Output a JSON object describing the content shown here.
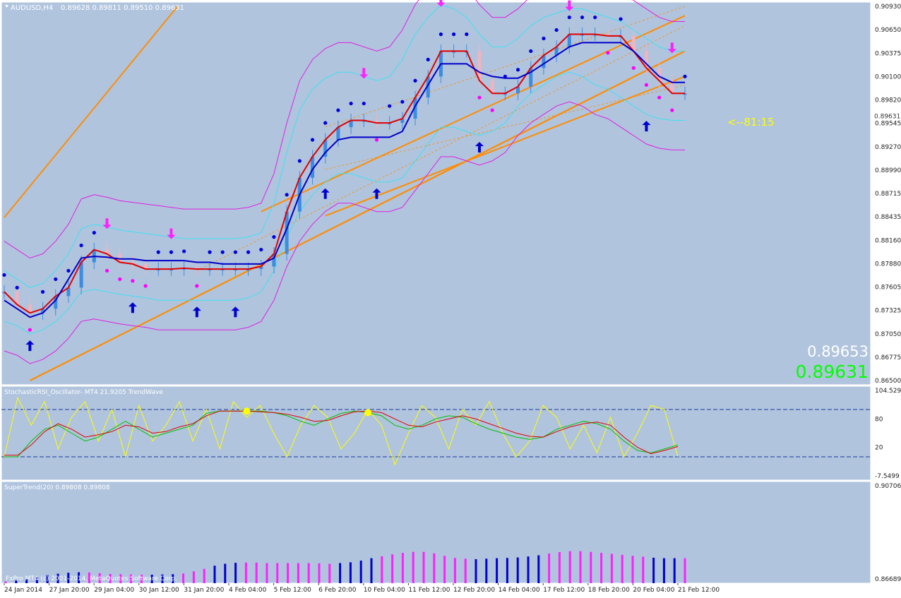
{
  "window": {
    "symbol_label": "AUDUSD,H4",
    "ohlc": "0.89628 0.89811 0.89510 0.89631",
    "arrow_icon": "triangle-down-icon"
  },
  "colors": {
    "background": "#b0c4de",
    "frame": "#ffffff",
    "text": "#ffffff",
    "orange": "#ff8c00",
    "cyan": "#40e0f0",
    "magenta": "#e020e0",
    "red": "#e00000",
    "blue": "#0000c8",
    "dot_blue": "#0000e0",
    "dot_magenta": "#ff00ff",
    "candle_blue": "#3c8ce0",
    "candle_pink": "#f0b4c0",
    "yellow": "#ffff00",
    "green": "#00c000",
    "bid_green": "#00ff00",
    "hist_blue": "#0000d0",
    "hist_magenta": "#ff20ff"
  },
  "chart_data": [
    {
      "type": "line",
      "name": "main",
      "ylim": [
        0.865,
        0.9093
      ],
      "y_ticks": [
        "0.90930",
        "0.90650",
        "0.90375",
        "0.90100",
        "0.89820",
        "0.89545",
        "0.89270",
        "0.88990",
        "0.88715",
        "0.88435",
        "0.88160",
        "0.87880",
        "0.87605",
        "0.87325",
        "0.87050",
        "0.86775",
        "0.86500"
      ],
      "current_price_tag": "0.89631",
      "countdown_label": "<--81:15",
      "ask_label": "0.89653",
      "bid_label": "0.89631",
      "series": [
        {
          "values": [
            0.8755,
            0.874,
            0.873,
            0.8735,
            0.875,
            0.876,
            0.879,
            0.8805,
            0.88,
            0.879,
            0.8788,
            0.8782,
            0.8782,
            0.8782,
            0.8783,
            0.8782,
            0.8782,
            0.8782,
            0.8782,
            0.8782,
            0.8785,
            0.88,
            0.885,
            0.889,
            0.8915,
            0.8935,
            0.895,
            0.8958,
            0.8958,
            0.8955,
            0.8955,
            0.896,
            0.8985,
            0.901,
            0.904,
            0.904,
            0.904,
            0.9005,
            0.899,
            0.899,
            0.8998,
            0.902,
            0.9035,
            0.9045,
            0.906,
            0.906,
            0.906,
            0.9058,
            0.9058,
            0.904,
            0.902,
            0.9005,
            0.899,
            0.899
          ]
        },
        {
          "values": [
            0.8745,
            0.8735,
            0.8725,
            0.873,
            0.8745,
            0.877,
            0.8795,
            0.8797,
            0.8796,
            0.8794,
            0.8794,
            0.8792,
            0.8792,
            0.8792,
            0.8792,
            0.879,
            0.879,
            0.8788,
            0.8788,
            0.8788,
            0.8788,
            0.8795,
            0.883,
            0.887,
            0.89,
            0.892,
            0.8935,
            0.8938,
            0.8938,
            0.8938,
            0.8938,
            0.8945,
            0.8975,
            0.9,
            0.9025,
            0.9025,
            0.9025,
            0.9015,
            0.901,
            0.9008,
            0.9008,
            0.9015,
            0.9025,
            0.9035,
            0.9045,
            0.905,
            0.905,
            0.905,
            0.905,
            0.904,
            0.9025,
            0.901,
            0.9003,
            0.9003
          ]
        },
        {
          "values": [
            0.878,
            0.877,
            0.876,
            0.8765,
            0.878,
            0.88,
            0.883,
            0.8835,
            0.8832,
            0.8828,
            0.8826,
            0.8824,
            0.8822,
            0.882,
            0.8818,
            0.8818,
            0.8818,
            0.8818,
            0.8818,
            0.882,
            0.8825,
            0.886,
            0.892,
            0.897,
            0.8995,
            0.9008,
            0.9015,
            0.9015,
            0.901,
            0.9005,
            0.901,
            0.903,
            0.906,
            0.908,
            0.9095,
            0.909,
            0.908,
            0.906,
            0.9045,
            0.9045,
            0.9055,
            0.907,
            0.908,
            0.9085,
            0.909,
            0.909,
            0.9085,
            0.908,
            0.9075,
            0.9065,
            0.9055,
            0.9045,
            0.904,
            0.904
          ]
        },
        {
          "values": [
            0.872,
            0.8715,
            0.8705,
            0.871,
            0.872,
            0.8735,
            0.8755,
            0.8758,
            0.8755,
            0.8752,
            0.875,
            0.8748,
            0.8745,
            0.8745,
            0.8745,
            0.8745,
            0.8745,
            0.8745,
            0.8745,
            0.8748,
            0.8755,
            0.878,
            0.882,
            0.885,
            0.887,
            0.8885,
            0.8895,
            0.8895,
            0.889,
            0.8885,
            0.8885,
            0.889,
            0.891,
            0.893,
            0.895,
            0.895,
            0.8945,
            0.894,
            0.8945,
            0.8955,
            0.8975,
            0.899,
            0.9,
            0.901,
            0.9015,
            0.901,
            0.9,
            0.8995,
            0.8985,
            0.8975,
            0.8965,
            0.896,
            0.8958,
            0.8958
          ]
        }
      ]
    },
    {
      "type": "line",
      "name": "oscillator",
      "title": "StochasticRSI_Oscillator- MT4 21.9205  TrendWave",
      "ylim": [
        -5,
        105
      ],
      "y_ticks": [
        "104.529",
        "80",
        "20",
        "-7.5499"
      ],
      "levels": [
        80,
        20
      ],
      "series": [
        {
          "values": [
            20,
            95,
            60,
            90,
            30,
            70,
            90,
            40,
            80,
            20,
            85,
            40,
            60,
            90,
            40,
            80,
            30,
            90,
            70,
            85,
            50,
            20,
            60,
            85,
            70,
            30,
            50,
            80,
            60,
            10,
            50,
            85,
            70,
            30,
            80,
            60,
            90,
            50,
            20,
            40,
            85,
            70,
            30,
            60,
            25,
            70,
            20,
            50,
            85,
            80,
            20
          ]
        },
        {
          "values": [
            20,
            20,
            40,
            55,
            60,
            50,
            40,
            45,
            55,
            65,
            55,
            45,
            50,
            55,
            60,
            75,
            78,
            78,
            78,
            78,
            76,
            72,
            65,
            60,
            68,
            75,
            78,
            76,
            72,
            60,
            55,
            60,
            68,
            72,
            70,
            62,
            55,
            50,
            45,
            42,
            45,
            55,
            60,
            65,
            62,
            55,
            40,
            28,
            25,
            30,
            35
          ]
        },
        {
          "values": [
            22,
            22,
            35,
            52,
            62,
            55,
            45,
            48,
            52,
            60,
            58,
            50,
            52,
            58,
            62,
            72,
            78,
            78,
            78,
            77,
            76,
            74,
            70,
            65,
            66,
            72,
            77,
            78,
            76,
            68,
            60,
            58,
            64,
            68,
            72,
            68,
            62,
            56,
            50,
            46,
            45,
            52,
            58,
            62,
            64,
            60,
            45,
            32,
            24,
            28,
            33
          ]
        }
      ]
    },
    {
      "type": "bar",
      "name": "supertrend",
      "title": "SuperTrend(20) 0.89808 0.89808",
      "ylim": [
        0.8669,
        0.90706
      ],
      "y_ticks": [
        "0.90706",
        "0.86689"
      ],
      "values": [
        0.8676,
        0.868,
        0.8686,
        0.8694,
        0.8702,
        0.8708,
        0.8712,
        0.8714,
        0.8713,
        0.871,
        0.8707,
        0.8706,
        0.8705,
        0.8704,
        0.8704,
        0.8705,
        0.8706,
        0.8709,
        0.8718,
        0.8728,
        0.8741,
        0.8749,
        0.8753,
        0.8754,
        0.8754,
        0.8752,
        0.8752,
        0.8752,
        0.8752,
        0.8752,
        0.8751,
        0.8749,
        0.8752,
        0.8755,
        0.8762,
        0.8772,
        0.878,
        0.8788,
        0.8794,
        0.8798,
        0.8798,
        0.8792,
        0.8782,
        0.8773,
        0.877,
        0.8768,
        0.877,
        0.8772,
        0.8773,
        0.8775,
        0.8779,
        0.8784,
        0.8791,
        0.8797,
        0.8801,
        0.8801,
        0.8798,
        0.8794,
        0.879,
        0.8786,
        0.8782,
        0.8778,
        0.8774,
        0.8772,
        0.8772,
        0.8772
      ],
      "colors": [
        "m",
        "b",
        "b",
        "b",
        "b",
        "b",
        "b",
        "b",
        "m",
        "m",
        "m",
        "m",
        "m",
        "m",
        "b",
        "b",
        "b",
        "m",
        "m",
        "m",
        "b",
        "b",
        "b",
        "m",
        "m",
        "m",
        "m",
        "m",
        "m",
        "m",
        "m",
        "m",
        "b",
        "b",
        "b",
        "b",
        "m",
        "m",
        "m",
        "m",
        "m",
        "m",
        "m",
        "m",
        "m",
        "b",
        "b",
        "b",
        "b",
        "b",
        "b",
        "b",
        "m",
        "m",
        "m",
        "m",
        "m",
        "m",
        "m",
        "m",
        "m",
        "m",
        "b",
        "b",
        "b",
        "m"
      ]
    }
  ],
  "x_axis": {
    "labels": [
      "24 Jan 2014",
      "27 Jan 20:00",
      "29 Jan 04:00",
      "30 Jan 12:00",
      "31 Jan 20:00",
      "4 Feb 04:00",
      "5 Feb 12:00",
      "6 Feb 20:00",
      "10 Feb 04:00",
      "11 Feb 12:00",
      "12 Feb 20:00",
      "14 Feb 04:00",
      "17 Feb 12:00",
      "18 Feb 20:00",
      "20 Feb 04:00",
      "21 Feb 12:00"
    ]
  },
  "footer": {
    "copyright": "FxPro MT4 (c) 2001-2014, MetaQuotes Software Corp."
  }
}
